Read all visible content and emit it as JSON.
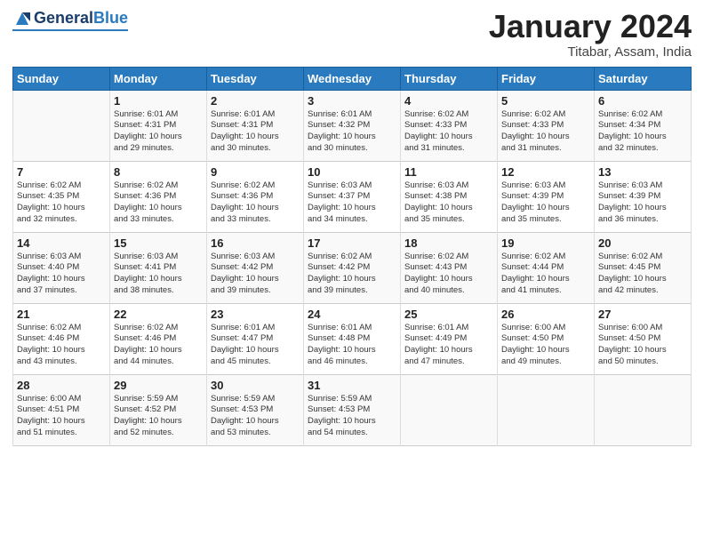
{
  "header": {
    "logo_general": "General",
    "logo_blue": "Blue",
    "month_title": "January 2024",
    "location": "Titabar, Assam, India"
  },
  "weekdays": [
    "Sunday",
    "Monday",
    "Tuesday",
    "Wednesday",
    "Thursday",
    "Friday",
    "Saturday"
  ],
  "weeks": [
    [
      {
        "day": "",
        "content": ""
      },
      {
        "day": "1",
        "content": "Sunrise: 6:01 AM\nSunset: 4:31 PM\nDaylight: 10 hours\nand 29 minutes."
      },
      {
        "day": "2",
        "content": "Sunrise: 6:01 AM\nSunset: 4:31 PM\nDaylight: 10 hours\nand 30 minutes."
      },
      {
        "day": "3",
        "content": "Sunrise: 6:01 AM\nSunset: 4:32 PM\nDaylight: 10 hours\nand 30 minutes."
      },
      {
        "day": "4",
        "content": "Sunrise: 6:02 AM\nSunset: 4:33 PM\nDaylight: 10 hours\nand 31 minutes."
      },
      {
        "day": "5",
        "content": "Sunrise: 6:02 AM\nSunset: 4:33 PM\nDaylight: 10 hours\nand 31 minutes."
      },
      {
        "day": "6",
        "content": "Sunrise: 6:02 AM\nSunset: 4:34 PM\nDaylight: 10 hours\nand 32 minutes."
      }
    ],
    [
      {
        "day": "7",
        "content": "Sunrise: 6:02 AM\nSunset: 4:35 PM\nDaylight: 10 hours\nand 32 minutes."
      },
      {
        "day": "8",
        "content": "Sunrise: 6:02 AM\nSunset: 4:36 PM\nDaylight: 10 hours\nand 33 minutes."
      },
      {
        "day": "9",
        "content": "Sunrise: 6:02 AM\nSunset: 4:36 PM\nDaylight: 10 hours\nand 33 minutes."
      },
      {
        "day": "10",
        "content": "Sunrise: 6:03 AM\nSunset: 4:37 PM\nDaylight: 10 hours\nand 34 minutes."
      },
      {
        "day": "11",
        "content": "Sunrise: 6:03 AM\nSunset: 4:38 PM\nDaylight: 10 hours\nand 35 minutes."
      },
      {
        "day": "12",
        "content": "Sunrise: 6:03 AM\nSunset: 4:39 PM\nDaylight: 10 hours\nand 35 minutes."
      },
      {
        "day": "13",
        "content": "Sunrise: 6:03 AM\nSunset: 4:39 PM\nDaylight: 10 hours\nand 36 minutes."
      }
    ],
    [
      {
        "day": "14",
        "content": "Sunrise: 6:03 AM\nSunset: 4:40 PM\nDaylight: 10 hours\nand 37 minutes."
      },
      {
        "day": "15",
        "content": "Sunrise: 6:03 AM\nSunset: 4:41 PM\nDaylight: 10 hours\nand 38 minutes."
      },
      {
        "day": "16",
        "content": "Sunrise: 6:03 AM\nSunset: 4:42 PM\nDaylight: 10 hours\nand 39 minutes."
      },
      {
        "day": "17",
        "content": "Sunrise: 6:02 AM\nSunset: 4:42 PM\nDaylight: 10 hours\nand 39 minutes."
      },
      {
        "day": "18",
        "content": "Sunrise: 6:02 AM\nSunset: 4:43 PM\nDaylight: 10 hours\nand 40 minutes."
      },
      {
        "day": "19",
        "content": "Sunrise: 6:02 AM\nSunset: 4:44 PM\nDaylight: 10 hours\nand 41 minutes."
      },
      {
        "day": "20",
        "content": "Sunrise: 6:02 AM\nSunset: 4:45 PM\nDaylight: 10 hours\nand 42 minutes."
      }
    ],
    [
      {
        "day": "21",
        "content": "Sunrise: 6:02 AM\nSunset: 4:46 PM\nDaylight: 10 hours\nand 43 minutes."
      },
      {
        "day": "22",
        "content": "Sunrise: 6:02 AM\nSunset: 4:46 PM\nDaylight: 10 hours\nand 44 minutes."
      },
      {
        "day": "23",
        "content": "Sunrise: 6:01 AM\nSunset: 4:47 PM\nDaylight: 10 hours\nand 45 minutes."
      },
      {
        "day": "24",
        "content": "Sunrise: 6:01 AM\nSunset: 4:48 PM\nDaylight: 10 hours\nand 46 minutes."
      },
      {
        "day": "25",
        "content": "Sunrise: 6:01 AM\nSunset: 4:49 PM\nDaylight: 10 hours\nand 47 minutes."
      },
      {
        "day": "26",
        "content": "Sunrise: 6:00 AM\nSunset: 4:50 PM\nDaylight: 10 hours\nand 49 minutes."
      },
      {
        "day": "27",
        "content": "Sunrise: 6:00 AM\nSunset: 4:50 PM\nDaylight: 10 hours\nand 50 minutes."
      }
    ],
    [
      {
        "day": "28",
        "content": "Sunrise: 6:00 AM\nSunset: 4:51 PM\nDaylight: 10 hours\nand 51 minutes."
      },
      {
        "day": "29",
        "content": "Sunrise: 5:59 AM\nSunset: 4:52 PM\nDaylight: 10 hours\nand 52 minutes."
      },
      {
        "day": "30",
        "content": "Sunrise: 5:59 AM\nSunset: 4:53 PM\nDaylight: 10 hours\nand 53 minutes."
      },
      {
        "day": "31",
        "content": "Sunrise: 5:59 AM\nSunset: 4:53 PM\nDaylight: 10 hours\nand 54 minutes."
      },
      {
        "day": "",
        "content": ""
      },
      {
        "day": "",
        "content": ""
      },
      {
        "day": "",
        "content": ""
      }
    ]
  ]
}
